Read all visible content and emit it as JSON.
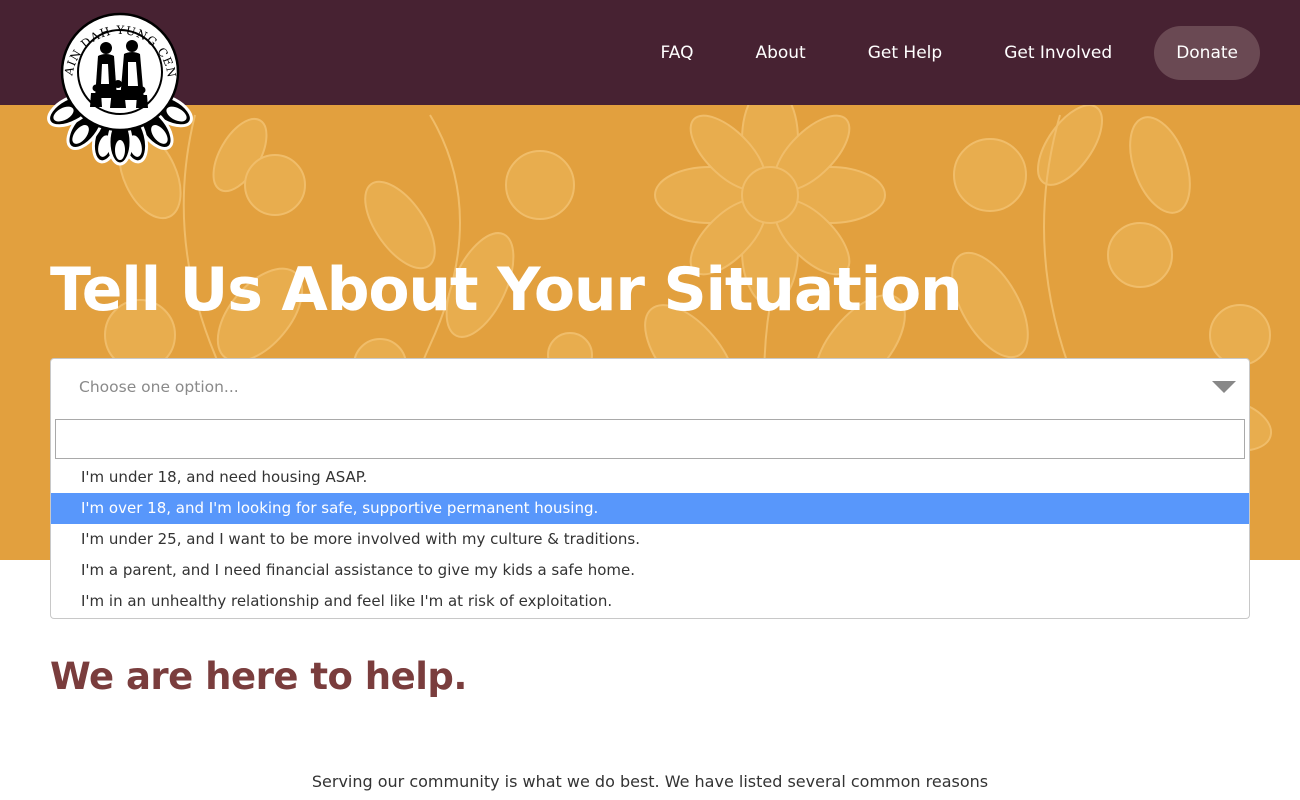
{
  "site": {
    "logo_name": "Ain Dah Yung Center logo"
  },
  "nav": {
    "items": [
      {
        "label": "FAQ"
      },
      {
        "label": "About"
      },
      {
        "label": "Get Help"
      },
      {
        "label": "Get Involved"
      }
    ],
    "donate_label": "Donate"
  },
  "hero": {
    "title": "Tell Us About Your Situation"
  },
  "situation_select": {
    "placeholder": "Choose one option...",
    "search_value": "",
    "options": [
      {
        "label": "I'm under 18, and need housing ASAP."
      },
      {
        "label": "I'm over 18, and I'm looking for safe, supportive permanent housing.",
        "highlighted": true
      },
      {
        "label": "I'm under 25, and I want to be more involved with my culture & traditions."
      },
      {
        "label": "I'm a parent, and I need financial assistance to give my kids a safe home."
      },
      {
        "label": "I'm in an unhealthy relationship and feel like I'm at risk of exploitation."
      }
    ]
  },
  "main": {
    "heading": "We are here to help.",
    "intro": "Serving our community is what we do best. We have listed several common reasons that"
  },
  "colors": {
    "header_bg": "#472232",
    "hero_bg": "#e2a03e",
    "highlight": "#5897fb",
    "heading": "#7a3d3d"
  }
}
